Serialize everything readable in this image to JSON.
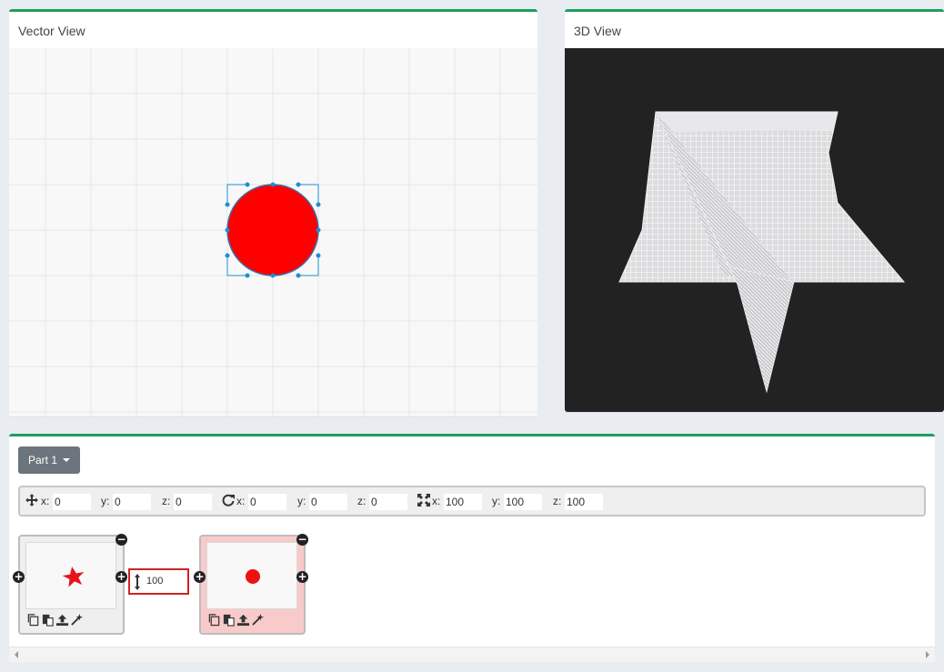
{
  "vector_view": {
    "title": "Vector View"
  },
  "view_3d": {
    "title": "3D View"
  },
  "part_selector": {
    "label": "Part 1"
  },
  "transform": {
    "position": {
      "x_label": "x:",
      "x": "0",
      "y_label": "y:",
      "y": "0",
      "z_label": "z:",
      "z": "0"
    },
    "rotation": {
      "x_label": "x:",
      "x": "0",
      "y_label": "y:",
      "y": "0",
      "z_label": "z:",
      "z": "0"
    },
    "scale": {
      "x_label": "x:",
      "x": "100",
      "y_label": "y:",
      "y": "100",
      "z_label": "z:",
      "z": "100"
    }
  },
  "layers": [
    {
      "shape": "star",
      "color": "#e8131b"
    },
    {
      "shape": "circle",
      "color": "#ee1111"
    }
  ],
  "height_field": {
    "value": "100"
  },
  "colors": {
    "accent": "#1e9e5e",
    "shape_fill": "#ff0000",
    "selection": "#1a8fd6",
    "layer_selected": "#f9caca",
    "highlight_border": "#d32222"
  },
  "icons": [
    "move-icon",
    "rotate-icon",
    "scale-icon",
    "height-icon",
    "copy-icon",
    "paste-icon",
    "upload-icon",
    "wand-icon",
    "plus-icon",
    "minus-icon"
  ]
}
